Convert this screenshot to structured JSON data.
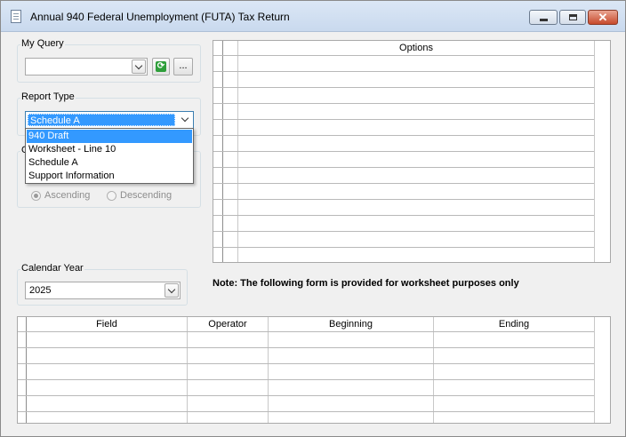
{
  "window": {
    "title": "Annual 940 Federal Unemployment (FUTA) Tax Return",
    "icons": {
      "app": "document-icon",
      "minimize": "minimize-icon",
      "maximize": "maximize-icon",
      "close": "close-icon"
    }
  },
  "my_query": {
    "label": "My Query",
    "value": "",
    "refresh_icon": "refresh-icon",
    "ellipsis_label": "..."
  },
  "report_type": {
    "label": "Report Type",
    "selected": "Schedule A",
    "options": [
      "940 Draft",
      "Worksheet - Line 10",
      "Schedule A",
      "Support Information"
    ],
    "highlighted_option": "940 Draft"
  },
  "order": {
    "label": "O",
    "ascending": "Ascending",
    "descending": "Descending",
    "selected": "Ascending"
  },
  "calendar_year": {
    "label": "Calendar Year",
    "value": "2025"
  },
  "options_grid": {
    "header": "Options"
  },
  "note": "Note: The following form is provided for worksheet purposes only",
  "criteria_grid": {
    "columns": [
      "Field",
      "Operator",
      "Beginning",
      "Ending"
    ]
  }
}
